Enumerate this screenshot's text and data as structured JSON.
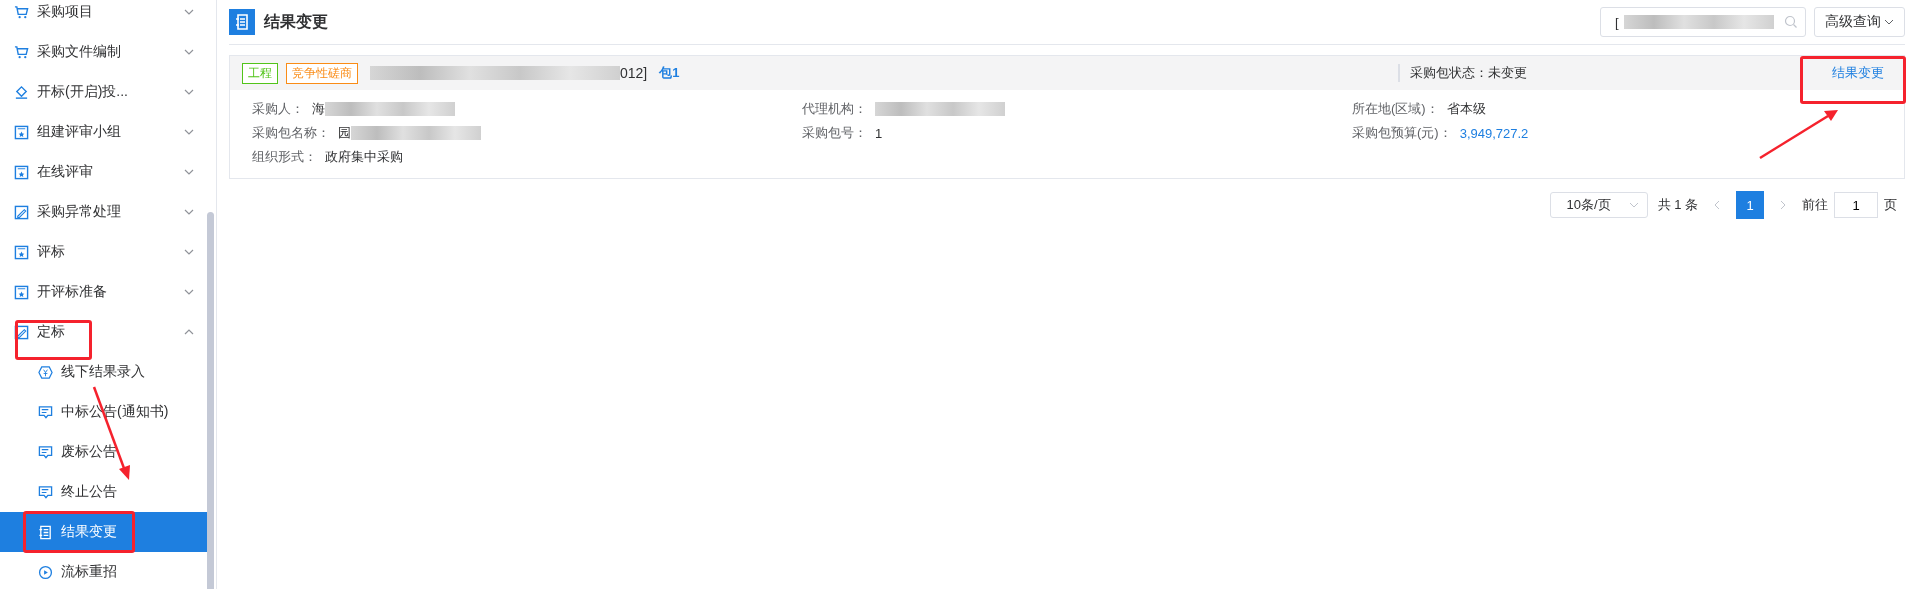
{
  "sidebar": {
    "items": [
      {
        "label": "采购项目",
        "kind": "cart",
        "expanded": false
      },
      {
        "label": "采购文件编制",
        "kind": "cart",
        "expanded": false
      },
      {
        "label": "开标(开启)投...",
        "kind": "diamond",
        "expanded": false
      },
      {
        "label": "组建评审小组",
        "kind": "starform",
        "expanded": false
      },
      {
        "label": "在线评审",
        "kind": "starform",
        "expanded": false
      },
      {
        "label": "采购异常处理",
        "kind": "editform",
        "expanded": false
      },
      {
        "label": "评标",
        "kind": "starform",
        "expanded": false
      },
      {
        "label": "开评标准备",
        "kind": "starform",
        "expanded": false
      },
      {
        "label": "定标",
        "kind": "editform",
        "expanded": true,
        "children": [
          {
            "label": "线下结果录入",
            "kind": "yuan",
            "selected": false
          },
          {
            "label": "中标公告(通知书)",
            "kind": "chat",
            "selected": false
          },
          {
            "label": "废标公告",
            "kind": "chat",
            "selected": false
          },
          {
            "label": "终止公告",
            "kind": "chat",
            "selected": false
          },
          {
            "label": "结果变更",
            "kind": "list",
            "selected": true
          },
          {
            "label": "流标重招",
            "kind": "play",
            "selected": false
          }
        ]
      }
    ]
  },
  "page_title": "结果变更",
  "search": {
    "value": "["
  },
  "advanced_button": "高级查询",
  "record": {
    "tags": [
      {
        "label": "工程",
        "color": "#52c41a"
      },
      {
        "label": "竞争性磋商",
        "color": "#fa8c16"
      }
    ],
    "title_end": "012]",
    "package": "包1",
    "status_label": "采购包状态：",
    "status": "未变更",
    "action": "结果变更",
    "fields": [
      {
        "label": "采购人：",
        "value": "海",
        "redacted": true
      },
      {
        "label": "代理机构：",
        "redacted": true
      },
      {
        "label": "所在地(区域)：",
        "value": "省本级"
      },
      {
        "label": "采购包名称：",
        "value": "园",
        "redacted": true
      },
      {
        "label": "采购包号：",
        "value": "1"
      },
      {
        "label": "采购包预算(元)：",
        "value": "3,949,727.2",
        "kind": "amount"
      },
      {
        "label": "组织形式：",
        "value": "政府集中采购"
      }
    ]
  },
  "pagination": {
    "page_size": "10条/页",
    "total": "共 1 条",
    "pages": [
      {
        "label": "1",
        "selected": true
      }
    ],
    "goto_label": "前往",
    "goto_value": "1",
    "suffix": "页"
  }
}
